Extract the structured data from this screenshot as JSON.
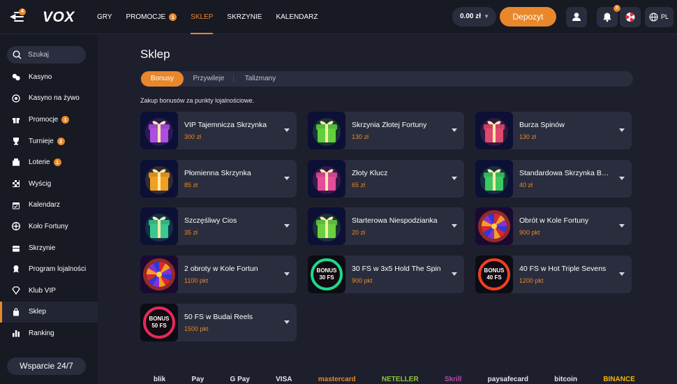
{
  "header": {
    "menu_badge": "4",
    "logo": "VOX",
    "nav": [
      {
        "label": "GRY",
        "badge": "",
        "active": false
      },
      {
        "label": "PROMOCJE",
        "badge": "1",
        "active": false
      },
      {
        "label": "SKLEP",
        "badge": "",
        "active": true
      },
      {
        "label": "SKRZYNIE",
        "badge": "",
        "active": false
      },
      {
        "label": "KALENDARZ",
        "badge": "",
        "active": false
      }
    ],
    "balance": "0.00 zł",
    "deposit_label": "Depozyt",
    "notifications_badge": "8",
    "language": "PL"
  },
  "sidebar": {
    "search_placeholder": "Szukaj",
    "items": [
      {
        "label": "Kasyno",
        "icon": "dice-icon",
        "badge": ""
      },
      {
        "label": "Kasyno na żywo",
        "icon": "live-casino-icon",
        "badge": ""
      },
      {
        "label": "Promocje",
        "icon": "gift-icon",
        "badge": "1"
      },
      {
        "label": "Turnieje",
        "icon": "trophy-icon",
        "badge": "2"
      },
      {
        "label": "Loterie",
        "icon": "lottery-icon",
        "badge": "1"
      },
      {
        "label": "Wyścig",
        "icon": "race-flag-icon",
        "badge": ""
      },
      {
        "label": "Kalendarz",
        "icon": "calendar-icon",
        "badge": ""
      },
      {
        "label": "Koło Fortuny",
        "icon": "wheel-icon",
        "badge": ""
      },
      {
        "label": "Skrzynie",
        "icon": "chest-icon",
        "badge": ""
      },
      {
        "label": "Program lojalności",
        "icon": "loyalty-icon",
        "badge": ""
      },
      {
        "label": "Klub VIP",
        "icon": "diamond-icon",
        "badge": ""
      },
      {
        "label": "Sklep",
        "icon": "shop-bag-icon",
        "badge": "",
        "active": true
      },
      {
        "label": "Ranking",
        "icon": "ranking-icon",
        "badge": ""
      }
    ],
    "support_label": "Wsparcie 24/7"
  },
  "main": {
    "title": "Sklep",
    "tabs": [
      "Bonusy",
      "Przywileje",
      "Talizmany"
    ],
    "description": "Zakup bonusów za punkty lojalnościowe.",
    "cards": [
      {
        "name": "VIP Tajemnicza Skrzynka",
        "price": "300 zł",
        "thumb": "gift",
        "color": "#b04de0"
      },
      {
        "name": "Skrzynia Złotej Fortuny",
        "price": "130 zł",
        "thumb": "gift",
        "color": "#5fd03c"
      },
      {
        "name": "Burza Spinów",
        "price": "130 zł",
        "thumb": "gift",
        "color": "#e0486e"
      },
      {
        "name": "Płomienna Skrzynka",
        "price": "85 zł",
        "thumb": "gift",
        "color": "#f0a020"
      },
      {
        "name": "Złoty Klucz",
        "price": "65 zł",
        "thumb": "gift",
        "color": "#e64c9a"
      },
      {
        "name": "Standardowa Skrzynka Bonusów",
        "price": "40 zł",
        "thumb": "gift",
        "color": "#3cc860"
      },
      {
        "name": "Szczęśliwy Cios",
        "price": "35 zł",
        "thumb": "gift",
        "color": "#38c890"
      },
      {
        "name": "Starterowa Niespodzianka",
        "price": "20 zł",
        "thumb": "gift",
        "color": "#6ad040"
      },
      {
        "name": "Obrót w Kole Fortuny",
        "price": "900 pkt",
        "thumb": "wheel",
        "color": "#e8401c"
      },
      {
        "name": "2 obroty w Kole Fortun",
        "price": "1100 pkt",
        "thumb": "wheel",
        "color": "#e8401c"
      },
      {
        "name": "30 FS w 3x5 Hold The Spin",
        "price": "900 pkt",
        "thumb": "bonus",
        "color": "#1fd88a",
        "thumb_text": [
          "BONUS",
          "30 FS"
        ]
      },
      {
        "name": "40 FS w Hot Triple Sevens",
        "price": "1200 pkt",
        "thumb": "bonus",
        "color": "#f04020",
        "thumb_text": [
          "BONUS",
          "40 FS"
        ]
      },
      {
        "name": "50 FS w Budai Reels",
        "price": "1500 pkt",
        "thumb": "bonus",
        "color": "#e8285a",
        "thumb_text": [
          "BONUS",
          "50 FS"
        ]
      }
    ]
  },
  "footer": {
    "payment_logos": [
      "blik",
      "Pay",
      "G Pay",
      "VISA",
      "mastercard",
      "NETELLER",
      "Skrill",
      "paysafecard",
      "bitcoin",
      "BINANCE"
    ]
  },
  "colors": {
    "accent": "#e8882b",
    "background": "#1d1f2c",
    "panel": "#2a2d3d"
  }
}
